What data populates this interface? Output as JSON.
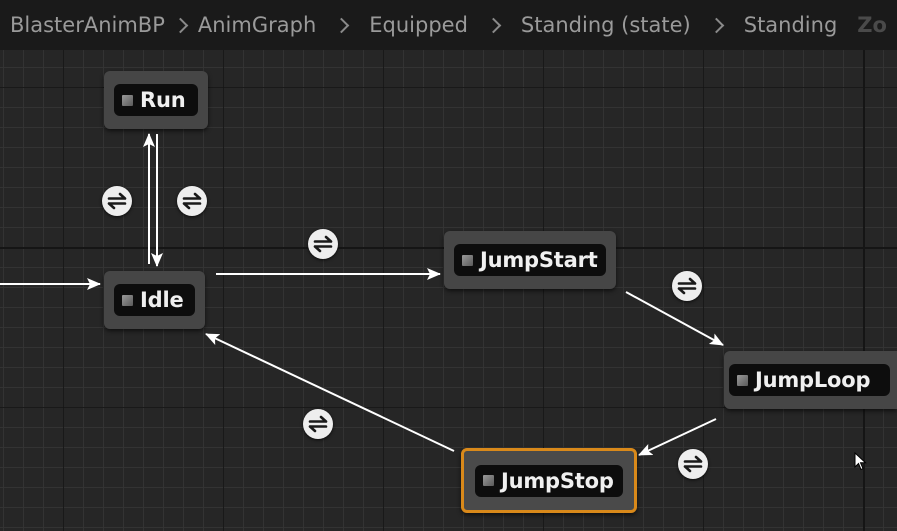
{
  "breadcrumb": {
    "items": [
      "BlasterAnimBP",
      "AnimGraph",
      "Equipped",
      "Standing (state)",
      "Standing",
      "Zo"
    ]
  },
  "states": {
    "run": "Run",
    "idle": "Idle",
    "jump_start": "JumpStart",
    "jump_loop": "JumpLoop",
    "jump_stop": "JumpStop"
  },
  "selected_state": "JumpStop",
  "colors": {
    "selection_border": "#d9891a",
    "canvas_bg": "#262626",
    "wire": "#ffffff"
  },
  "icons": {
    "transition": "transition-rule-icon",
    "state": "state-icon",
    "cursor": "mouse-cursor-icon"
  }
}
